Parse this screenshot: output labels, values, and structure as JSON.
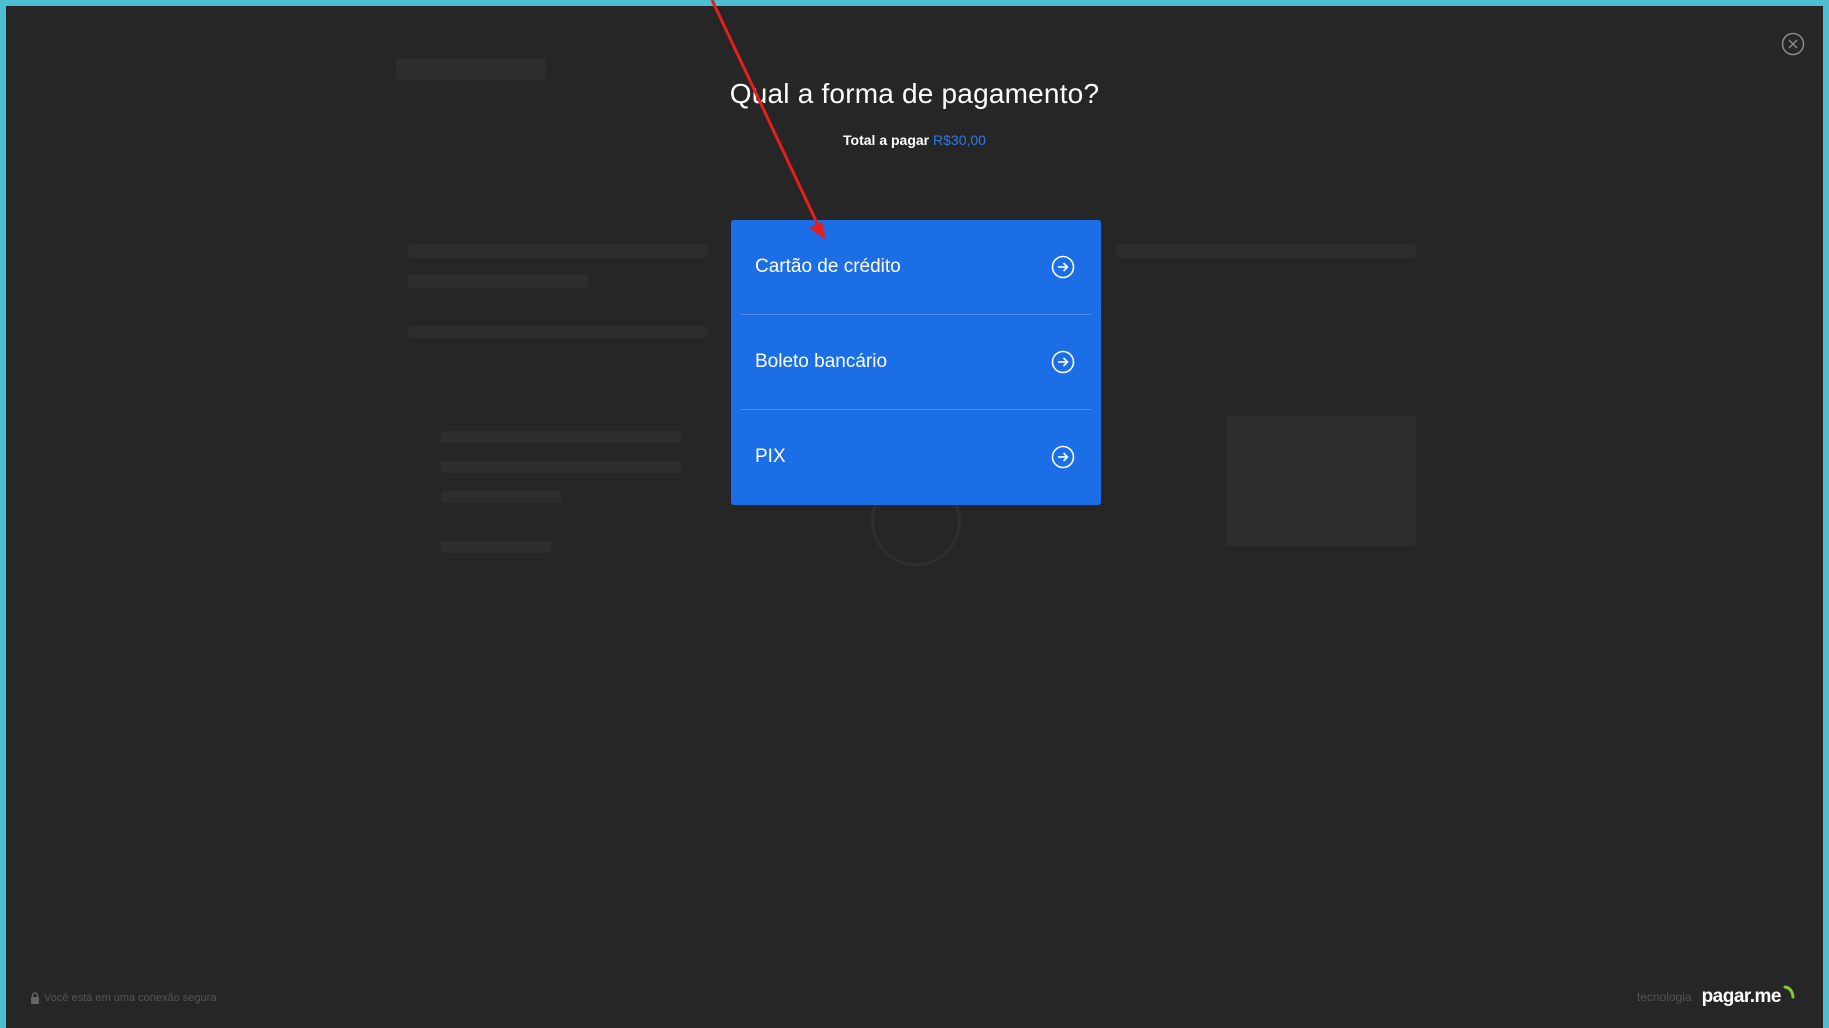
{
  "dialog": {
    "title": "Qual a forma de pagamento?",
    "total_label": "Total a pagar",
    "total_amount": "R$30,00"
  },
  "payment_options": [
    {
      "label": "Cartão de crédito",
      "icon": "arrow-right-circle-icon"
    },
    {
      "label": "Boleto bancário",
      "icon": "arrow-right-circle-icon"
    },
    {
      "label": "PIX",
      "icon": "arrow-right-circle-icon"
    }
  ],
  "footer": {
    "secure_text": "Você está em uma conexão segura",
    "tech_label": "tecnologia",
    "brand_name": "pagar.me"
  },
  "colors": {
    "accent": "#1b6ee6",
    "background": "#262626",
    "frame": "#4bbfd0",
    "annotation_arrow": "#e81e1e"
  }
}
